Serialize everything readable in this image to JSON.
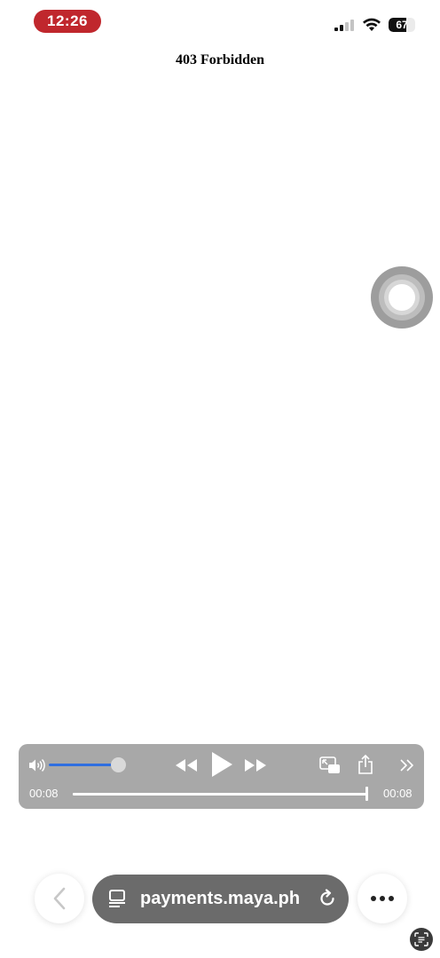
{
  "status_bar": {
    "time": "12:26",
    "battery_level": "67",
    "battery_fill": 0.67,
    "time_pill_color": "#c0272d"
  },
  "page": {
    "heading": "403 Forbidden"
  },
  "media_player": {
    "elapsed": "00:08",
    "remaining": "00:08",
    "volume_level": 0.92,
    "progress": 1.0,
    "accent_color": "#2f6fe0",
    "icons": [
      "volume-icon",
      "rewind-icon",
      "play-icon",
      "fast-forward-icon",
      "picture-in-picture-icon",
      "share-icon",
      "chevrons-right-icon"
    ]
  },
  "browser_bar": {
    "url": "payments.maya.ph",
    "icons": [
      "back-chevron-icon",
      "page-icon",
      "reload-icon",
      "more-icon",
      "scan-text-icon"
    ]
  }
}
